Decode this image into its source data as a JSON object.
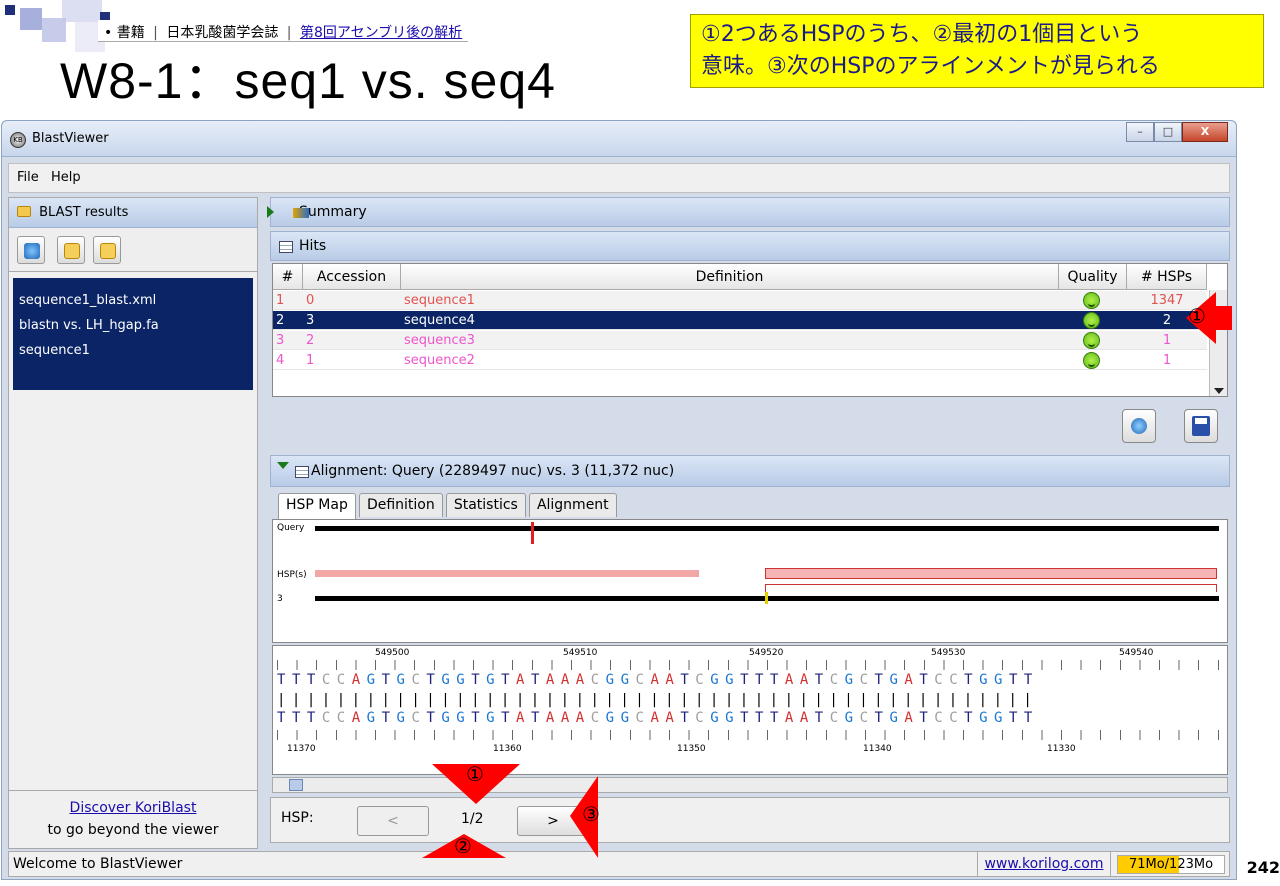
{
  "slide": {
    "breadcrumb": {
      "bullet": "•",
      "item1": "書籍",
      "item2": "日本乳酸菌学会誌",
      "item3": "第8回アセンブリ後の解析",
      "sep": "|"
    },
    "title": "W8-1：seq1 vs. seq4",
    "callout_line1": "①2つあるHSPのうち、②最初の1個目という",
    "callout_line2": "意味。③次のHSPのアラインメントが見られる",
    "page_number": "242"
  },
  "window": {
    "title": "BlastViewer",
    "app_icon_text": "KB",
    "minimize": "–",
    "maximize": "□",
    "close": "X"
  },
  "menu": {
    "file": "File",
    "help": "Help"
  },
  "left_panel": {
    "header": "BLAST results",
    "items": [
      "sequence1_blast.xml",
      "blastn vs. LH_hgap.fa",
      "sequence1"
    ],
    "footer_link": "Discover KoriBlast",
    "footer_text": "to go beyond the viewer"
  },
  "summary": {
    "label": "Summary"
  },
  "hits": {
    "label": "Hits",
    "columns": [
      "#",
      "Accession",
      "Definition",
      "Quality",
      "# HSPs"
    ],
    "rows": [
      {
        "num": "1",
        "accession": "0",
        "definition": "sequence1",
        "hsps": "1347",
        "color": "#e05252"
      },
      {
        "num": "2",
        "accession": "3",
        "definition": "sequence4",
        "hsps": "2",
        "color": "#ffffff"
      },
      {
        "num": "3",
        "accession": "2",
        "definition": "sequence3",
        "hsps": "1",
        "color": "#ee55cc"
      },
      {
        "num": "4",
        "accession": "1",
        "definition": "sequence2",
        "hsps": "1",
        "color": "#ee55cc"
      }
    ]
  },
  "alignment": {
    "header": "Alignment: Query (2289497 nuc) vs. 3 (11,372 nuc)",
    "tabs": [
      "HSP Map",
      "Definition",
      "Statistics",
      "Alignment"
    ],
    "map_labels": {
      "query": "Query",
      "hsps": "HSP(s)",
      "subject": "3"
    },
    "top_positions": [
      "549500",
      "549510",
      "549520",
      "549530",
      "549540"
    ],
    "bottom_positions": [
      "11370",
      "11360",
      "11350",
      "11340",
      "11330"
    ],
    "query_seq": "TTTCCAGTGCTGGTGTATAAACGGCAATCGGTTTAATCGCTGATCCTGGTT",
    "subject_seq": "TTTCCAGTGCTGGTGTATAAACGGCAATCGGTTTAATCGCTGATCCTGGTT",
    "match_line": "|||||||||||||||||||||||||||||||||||||||||||||||||||"
  },
  "hsp_nav": {
    "label": "HSP:",
    "prev": "<",
    "count": "1/2",
    "next": ">"
  },
  "status": {
    "welcome": "Welcome to BlastViewer",
    "link": "www.korilog.com",
    "memory": "71Mo/123Mo",
    "memory_fraction": 0.577
  },
  "annotations": {
    "a1": "①",
    "a2": "②",
    "a3": "③"
  },
  "colors": {
    "selection": "#0a2466",
    "header_grad": "#b8cbe6",
    "annot_red": "#ff0000",
    "callout_bg": "#ffff00"
  }
}
